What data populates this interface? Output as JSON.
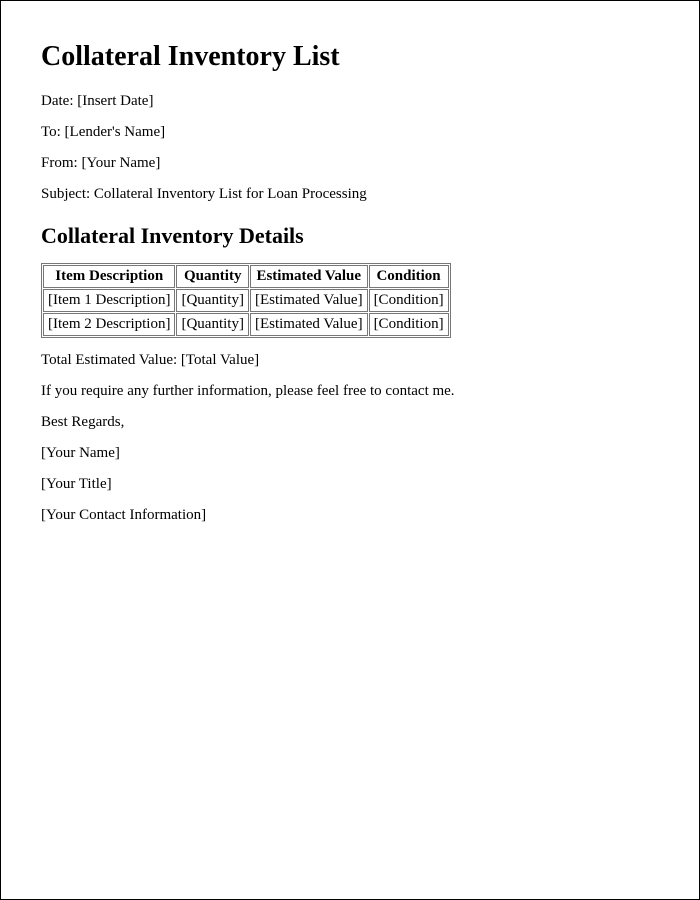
{
  "title": "Collateral Inventory List",
  "meta": {
    "date_label": "Date:",
    "date_value": "[Insert Date]",
    "to_label": "To:",
    "to_value": "[Lender's Name]",
    "from_label": "From:",
    "from_value": "[Your Name]",
    "subject_label": "Subject:",
    "subject_value": "Collateral Inventory List for Loan Processing"
  },
  "section_heading": "Collateral Inventory Details",
  "table": {
    "headers": {
      "item": "Item Description",
      "quantity": "Quantity",
      "value": "Estimated Value",
      "condition": "Condition"
    },
    "rows": [
      {
        "item": "[Item 1 Description]",
        "quantity": "[Quantity]",
        "value": "[Estimated Value]",
        "condition": "[Condition]"
      },
      {
        "item": "[Item 2 Description]",
        "quantity": "[Quantity]",
        "value": "[Estimated Value]",
        "condition": "[Condition]"
      }
    ]
  },
  "footer": {
    "total_label": "Total Estimated Value:",
    "total_value": "[Total Value]",
    "closing_line": "If you require any further information, please feel free to contact me.",
    "signoff": "Best Regards,",
    "name": "[Your Name]",
    "title": "[Your Title]",
    "contact": "[Your Contact Information]"
  }
}
